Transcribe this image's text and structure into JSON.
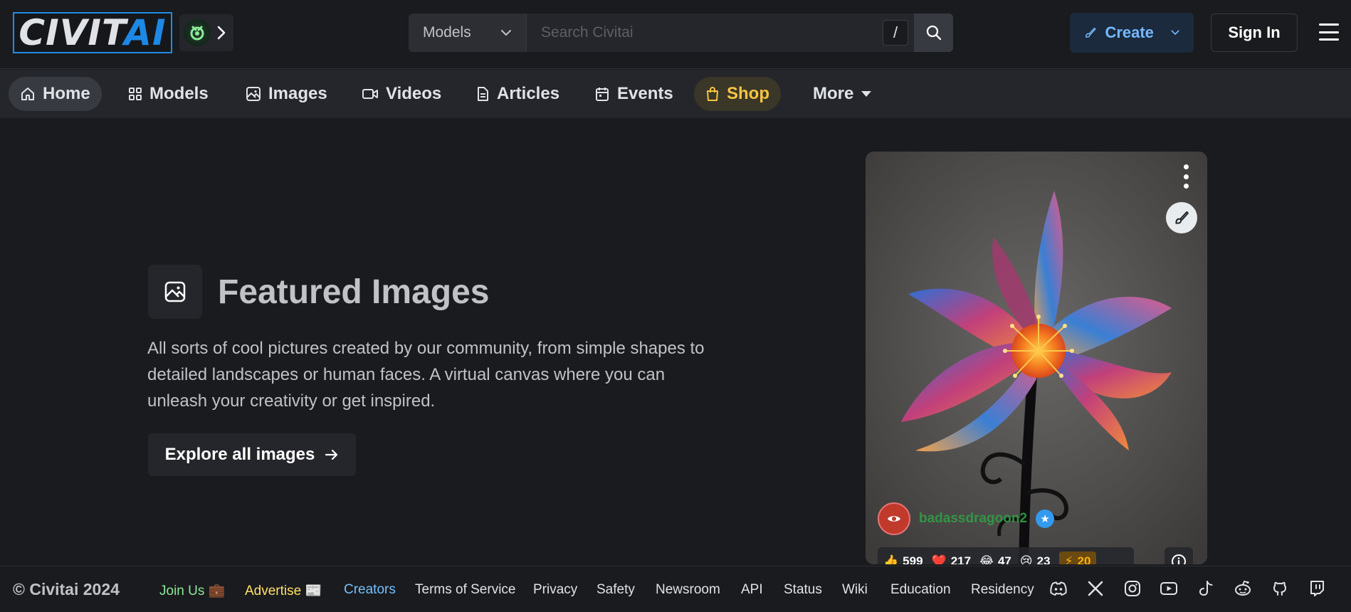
{
  "header": {
    "logo": {
      "part1": "CIVIT",
      "part2": "AI"
    },
    "search": {
      "category": "Models",
      "placeholder": "Search Civitai",
      "shortcut": "/"
    },
    "create_label": "Create",
    "signin_label": "Sign In"
  },
  "nav": {
    "items": [
      {
        "label": "Home",
        "icon": "home-icon",
        "active": true
      },
      {
        "label": "Models",
        "icon": "grid-icon"
      },
      {
        "label": "Images",
        "icon": "photo-icon"
      },
      {
        "label": "Videos",
        "icon": "video-icon"
      },
      {
        "label": "Articles",
        "icon": "file-text-icon"
      },
      {
        "label": "Events",
        "icon": "calendar-icon"
      },
      {
        "label": "Shop",
        "icon": "shopping-bag-icon"
      },
      {
        "label": "More",
        "icon": "caret-down-icon"
      }
    ]
  },
  "hero": {
    "title": "Featured Images",
    "description": "All sorts of cool pictures created by our community, from simple shapes to detailed landscapes or human faces. A virtual canvas where you can unleash your creativity or get inspired.",
    "cta_label": "Explore all images"
  },
  "card": {
    "username": "badassdragoon2",
    "reactions": {
      "like": "599",
      "heart": "217",
      "laugh": "47",
      "cry": "23",
      "buzz": "20"
    }
  },
  "footer": {
    "copyright": "© Civitai 2024",
    "links": {
      "join_us": "Join Us 💼",
      "advertise": "Advertise 📰",
      "creators": "Creators",
      "tos": "Terms of Service",
      "privacy": "Privacy",
      "safety": "Safety",
      "newsroom": "Newsroom",
      "api": "API",
      "status": "Status",
      "wiki": "Wiki",
      "education": "Education",
      "residency": "Residency"
    },
    "social": [
      "discord-icon",
      "x-icon",
      "instagram-icon",
      "youtube-icon",
      "tiktok-icon",
      "reddit-icon",
      "github-icon",
      "twitch-icon"
    ]
  },
  "colors": {
    "background": "#1a1b1e",
    "nav_background": "#25262b",
    "accent_blue": "#228be6",
    "shop_yellow": "#f5c542",
    "username_green": "#2f9e44"
  }
}
